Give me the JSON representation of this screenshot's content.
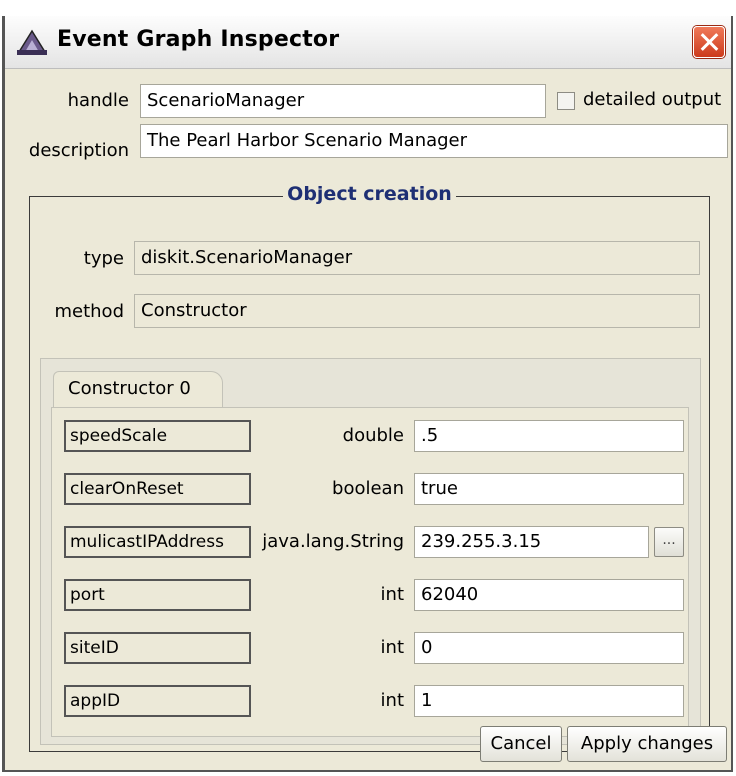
{
  "window": {
    "title": "Event Graph Inspector"
  },
  "top": {
    "handle_label": "handle",
    "handle_value": "ScenarioManager",
    "detailed_label": "detailed output",
    "description_label": "description",
    "description_value": "The Pearl Harbor Scenario Manager"
  },
  "object_creation": {
    "title": "Object creation",
    "type_label": "type",
    "type_value": "diskit.ScenarioManager",
    "method_label": "method",
    "method_value": "Constructor"
  },
  "tabs": [
    {
      "label": "Constructor 0"
    }
  ],
  "params": [
    {
      "name": "speedScale",
      "type": "double",
      "value": ".5"
    },
    {
      "name": "clearOnReset",
      "type": "boolean",
      "value": "true"
    },
    {
      "name": "mulicastIPAddress",
      "type": "java.lang.String",
      "value": "239.255.3.15",
      "button": "..."
    },
    {
      "name": "port",
      "type": "int",
      "value": "62040"
    },
    {
      "name": "siteID",
      "type": "int",
      "value": "0"
    },
    {
      "name": "appID",
      "type": "int",
      "value": "1"
    }
  ],
  "buttons": {
    "cancel": "Cancel",
    "apply": "Apply changes"
  }
}
